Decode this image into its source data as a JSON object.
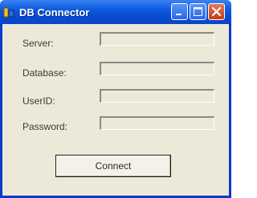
{
  "window": {
    "title": "DB Connector"
  },
  "titlebar": {
    "icons": [
      "app-icon",
      "minimize-icon",
      "maximize-icon",
      "close-icon"
    ]
  },
  "form": {
    "server_label": "Server:",
    "database_label": "Database:",
    "userid_label": "UserID:",
    "password_label": "Password:",
    "server_value": "",
    "database_value": "",
    "userid_value": "",
    "password_value": ""
  },
  "actions": {
    "connect_label": "Connect"
  },
  "colors": {
    "titlebar": "#0a4ad0",
    "window_bg": "#ece9d8",
    "close_button": "#c43a14"
  }
}
